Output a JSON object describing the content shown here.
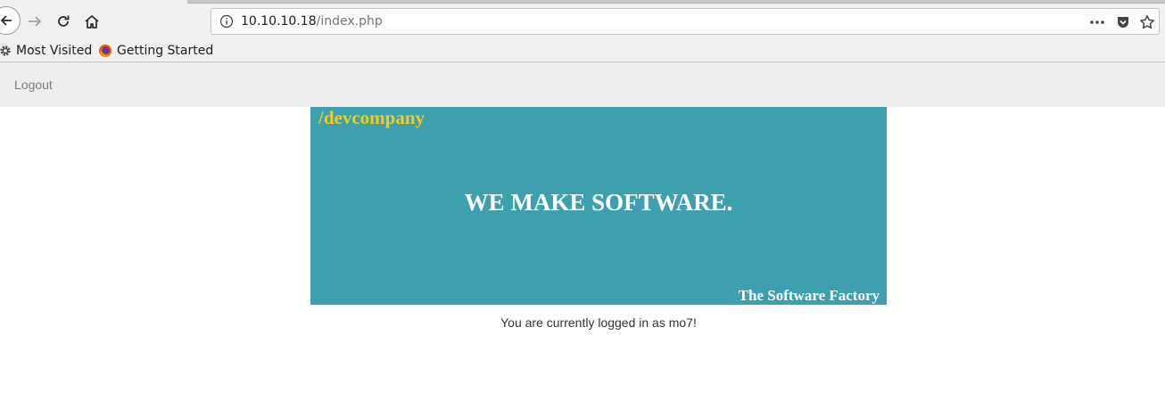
{
  "browser": {
    "url_host": "10.10.10.18",
    "url_path": "/index.php",
    "bookmarks": [
      {
        "label": "Most Visited",
        "icon": "gear-icon"
      },
      {
        "label": "Getting Started",
        "icon": "firefox-icon"
      }
    ]
  },
  "page": {
    "nav": {
      "logout_label": "Logout"
    },
    "banner": {
      "brand": "/devcompany",
      "headline": "WE MAKE SOFTWARE.",
      "tagline": "The Software Factory",
      "colors": {
        "background": "#3e9faf",
        "brand": "#f0cd1e",
        "text": "#ffffff"
      }
    },
    "status_text": "You are currently logged in as mo7!"
  }
}
